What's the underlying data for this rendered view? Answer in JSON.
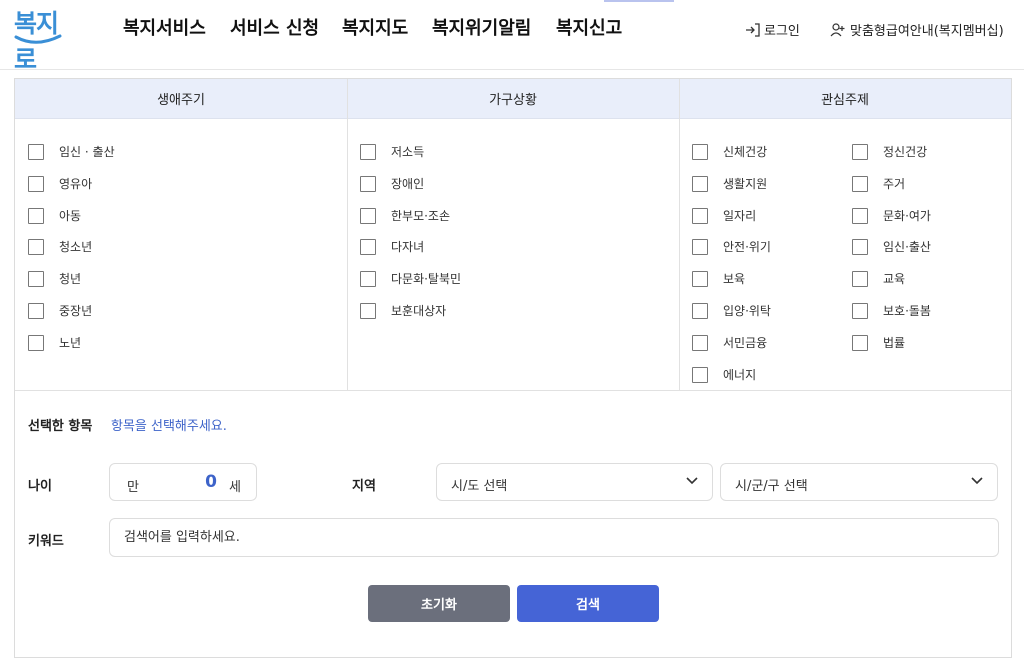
{
  "header": {
    "logo_text": "복지로",
    "nav": [
      {
        "label": "복지서비스"
      },
      {
        "label": "서비스 신청"
      },
      {
        "label": "복지지도"
      },
      {
        "label": "복지위기알림"
      },
      {
        "label": "복지신고"
      }
    ],
    "login_label": "로그인",
    "membership_label": "맞춤형급여안내(복지멤버십)",
    "icons": [
      "login-icon",
      "user-add-icon"
    ],
    "accent_color": "#3a8fd6"
  },
  "filter": {
    "columns": [
      {
        "title": "생애주기",
        "items": [
          "임신 · 출산",
          "영유아",
          "아동",
          "청소년",
          "청년",
          "중장년",
          "노년"
        ]
      },
      {
        "title": "가구상황",
        "items": [
          "저소득",
          "장애인",
          "한부모·조손",
          "다자녀",
          "다문화·탈북민",
          "보훈대상자"
        ]
      },
      {
        "title": "관심주제",
        "items_left": [
          "신체건강",
          "생활지원",
          "일자리",
          "안전·위기",
          "보육",
          "입양·위탁",
          "서민금융",
          "에너지"
        ],
        "items_right": [
          "정신건강",
          "주거",
          "문화·여가",
          "임신·출산",
          "교육",
          "보호·돌봄",
          "법률"
        ]
      }
    ],
    "header_bg_color": "#e9eefa"
  },
  "selected": {
    "label": "선택한 항목",
    "value": "항목을 선택해주세요."
  },
  "age": {
    "label": "나이",
    "prefix": "만",
    "value": "0",
    "suffix": "세"
  },
  "region": {
    "label": "지역",
    "sido": "시/도 선택",
    "sigungu": "시/군/구 선택"
  },
  "keyword": {
    "label": "키워드",
    "placeholder": "검색어를 입력하세요."
  },
  "buttons": {
    "reset": "초기화",
    "search": "검색",
    "reset_color": "#6b6f7c",
    "search_color": "#4564d6"
  }
}
